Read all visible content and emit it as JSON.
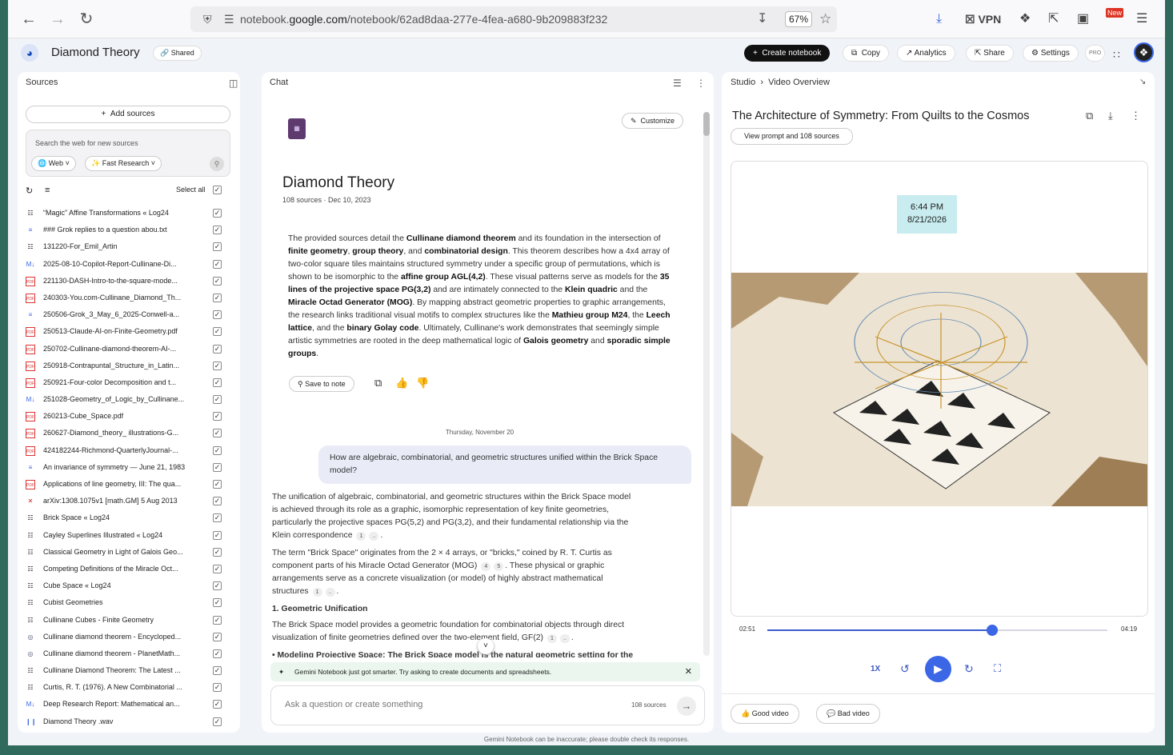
{
  "browser": {
    "url_prefix": "notebook.",
    "url_domain": "google.com",
    "url_path": "/notebook/62ad8daa-277e-4fea-a680-9b209883f232",
    "zoom": "67%",
    "vpn": "VPN",
    "new_badge": "New"
  },
  "header": {
    "title": "Diamond Theory",
    "shared": "Shared",
    "create": "Create notebook",
    "copy": "Copy",
    "analytics": "Analytics",
    "share": "Share",
    "settings": "Settings",
    "pro": "PRO"
  },
  "sources": {
    "title": "Sources",
    "add": "Add sources",
    "search_placeholder": "Search the web for new sources",
    "web": "Web",
    "fast": "Fast Research",
    "select_all": "Select all",
    "items": [
      {
        "icon": "grid",
        "name": "“Magic” Affine Transformations « Log24"
      },
      {
        "icon": "doc",
        "name": "### Grok replies to a question abou.txt"
      },
      {
        "icon": "grid",
        "name": "131220-For_Emil_Artin"
      },
      {
        "icon": "md",
        "name": "2025-08-10-Copilot-Report-Cullinane-Di..."
      },
      {
        "icon": "pdf",
        "name": "221130-DASH-Intro-to-the-square-mode..."
      },
      {
        "icon": "pdf",
        "name": "240303-You.com-Cullinane_Diamond_Th..."
      },
      {
        "icon": "doc",
        "name": "250506-Grok_3_May_6_2025-Conwell-a..."
      },
      {
        "icon": "pdf",
        "name": "250513-Claude-AI-on-Finite-Geometry.pdf"
      },
      {
        "icon": "pdf",
        "name": "250702-Cullinane-diamond-theorem-AI-..."
      },
      {
        "icon": "pdf",
        "name": "250918-Contrapuntal_Structure_in_Latin..."
      },
      {
        "icon": "pdf",
        "name": "250921-Four-color Decomposition and t..."
      },
      {
        "icon": "md",
        "name": "251028-Geometry_of_Logic_by_Cullinane..."
      },
      {
        "icon": "pdf",
        "name": "260213-Cube_Space.pdf"
      },
      {
        "icon": "pdf",
        "name": "260627-Diamond_theory_ illustrations-G..."
      },
      {
        "icon": "pdf",
        "name": "424182244-Richmond-QuarterlyJournal-..."
      },
      {
        "icon": "doc",
        "name": "An invariance of symmetry — June 21, 1983"
      },
      {
        "icon": "pdf",
        "name": "Applications of line geometry, III: The qua..."
      },
      {
        "icon": "x",
        "name": "arXiv:1308.1075v1 [math.GM] 5 Aug 2013"
      },
      {
        "icon": "grid",
        "name": "Brick Space « Log24"
      },
      {
        "icon": "grid",
        "name": "Cayley Superlines Illustrated « Log24"
      },
      {
        "icon": "grid",
        "name": "Classical Geometry in Light of Galois Geo..."
      },
      {
        "icon": "grid",
        "name": "Competing Definitions of the Miracle Oct..."
      },
      {
        "icon": "grid",
        "name": "Cube Space « Log24"
      },
      {
        "icon": "grid",
        "name": "Cubist Geometries"
      },
      {
        "icon": "grid",
        "name": "Cullinane Cubes - Finite Geometry"
      },
      {
        "icon": "globe",
        "name": "Cullinane diamond theorem - Encycloped..."
      },
      {
        "icon": "globe",
        "name": "Cullinane diamond theorem - PlanetMath..."
      },
      {
        "icon": "grid",
        "name": "Cullinane Diamond Theorem: The Latest ..."
      },
      {
        "icon": "grid",
        "name": "Curtis, R. T. (1976). A New Combinatorial ..."
      },
      {
        "icon": "md",
        "name": "Deep Research Report: Mathematical an..."
      },
      {
        "icon": "audio",
        "name": "Diamond Theory .wav"
      }
    ]
  },
  "chat": {
    "title": "Chat",
    "customize": "Customize",
    "nb_title": "Diamond Theory",
    "nb_sub": "108 sources · Dec 10, 2023",
    "save_note": "Save to note",
    "date": "Thursday, November 20",
    "question": "How are algebraic, combinatorial, and geometric structures unified within the Brick Space model?",
    "a_p1": "The unification of algebraic, combinatorial, and geometric structures within the Brick Space model is achieved through its role as a graphic, isomorphic representation of key finite geometries, particularly the projective spaces PG(5,2) and PG(3,2), and their fundamental relationship via the Klein correspondence",
    "a_p2": "The term \"Brick Space\" originates from the 2 × 4 arrays, or \"bricks,\" coined by R. T. Curtis as component parts of his Miracle Octad Generator (MOG)",
    "a_p2b": ". These physical or graphic arrangements serve as a concrete visualization (or model) of highly abstract mathematical structures",
    "a_h": "1. Geometric Unification",
    "a_p3": "The Brick Space model provides a geometric foundation for combinatorial objects through direct visualization of finite geometries defined over the two-element field, GF(2)",
    "a_p4": "• Modeling Projective Space: The Brick Space model is the natural geometric setting for the",
    "banner": "Gemini Notebook just got smarter. Try asking to create documents and spreadsheets.",
    "input_placeholder": "Ask a question or create something",
    "input_count": "108 sources"
  },
  "studio": {
    "crumb1": "Studio",
    "crumb2": "Video Overview",
    "video_title": "The Architecture of Symmetry: From Quilts to the Cosmos",
    "view_prompt": "View prompt and 108 sources",
    "clock_time": "6:44 PM",
    "clock_date": "8/21/2026",
    "t_cur": "02:51",
    "t_end": "04:19",
    "progress": 0.66,
    "speed": "1X",
    "good": "Good video",
    "bad": "Bad video"
  },
  "footer": "Gemini Notebook can be inaccurate; please double check its responses."
}
